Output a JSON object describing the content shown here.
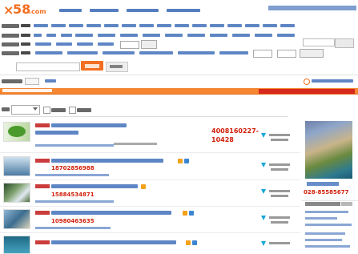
{
  "logo": {
    "x": "×",
    "num": "58",
    "com": ".com",
    "city": ""
  },
  "listings": [
    {
      "phone": "4008160227-10428"
    },
    {
      "phone": "18702856988"
    },
    {
      "phone": "15884534871"
    },
    {
      "phone": "10980463635"
    }
  ],
  "ad": {
    "phone": "028-85585677"
  },
  "colors": {
    "brand": "#f26f21",
    "link": "#2a5db0",
    "phone": "#d0200a",
    "promo": "#d01919",
    "band": "#f58632"
  }
}
